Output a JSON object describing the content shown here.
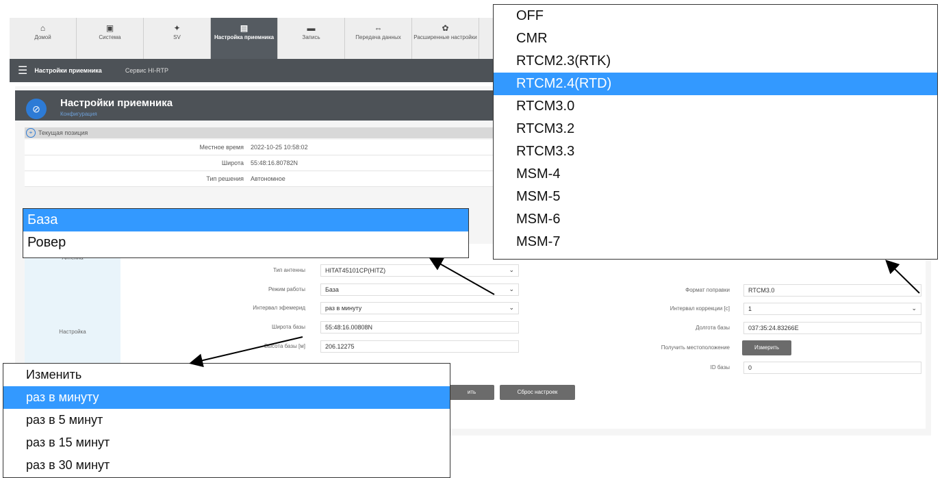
{
  "tabs": [
    {
      "icon": "home-icon",
      "glyph": "⌂",
      "label": "Домой"
    },
    {
      "icon": "system-icon",
      "glyph": "▣",
      "label": "Система"
    },
    {
      "icon": "sv-icon",
      "glyph": "✦",
      "label": "SV"
    },
    {
      "icon": "receiver-icon",
      "glyph": "▤",
      "label": "Настройка приемника"
    },
    {
      "icon": "record-icon",
      "glyph": "▬",
      "label": "Запись"
    },
    {
      "icon": "transfer-icon",
      "glyph": "⇔",
      "label": "Передача данных"
    },
    {
      "icon": "gear-icon",
      "glyph": "✿",
      "label": "Расширенные настройки"
    }
  ],
  "navbar": {
    "crumb": "Настройки приемника",
    "crumb2": "Сервис HI-RTP"
  },
  "page": {
    "title": "Настройки приемника",
    "subtitle": "Конфигурация"
  },
  "position": {
    "section": "Текущая позиция",
    "rows": [
      {
        "label": "Местное время",
        "value": "2022-10-25 10:58:02"
      },
      {
        "label": "Широта",
        "value": "55:48:16.80782N"
      },
      {
        "label": "Тип решения",
        "value": "Автономное"
      }
    ]
  },
  "settings": {
    "antenna_section": "Антенна",
    "setup_section": "Настройка",
    "antenna_type_label": "Тип антенны",
    "antenna_type_value": "HITAT45101CP(HITZ)",
    "mode_label": "Режим работы",
    "mode_value": "База",
    "ephem_label": "Интервал эфемерид",
    "ephem_value": "раз в минуту",
    "lat_label": "Широта базы",
    "lat_value": "55:48:16.00808N",
    "height_label": "Высота базы [м]",
    "height_value": "206.12275",
    "format_label": "Формат поправки",
    "format_value": "RTCM3.0",
    "corr_label": "Интервал коррекции [с]",
    "corr_value": "1",
    "lon_label": "Долгота базы",
    "lon_value": "037:35:24.83266E",
    "getpos_label": "Получить местоположение",
    "measure_btn": "Измерить",
    "id_label": "ID базы",
    "id_value": "0",
    "save_btn": "ить",
    "reset_btn": "Сброс настроек"
  },
  "dropdown_format": {
    "options": [
      "OFF",
      "CMR",
      "RTCM2.3(RTK)",
      "RTCM2.4(RTD)",
      "RTCM3.0",
      "RTCM3.2",
      "RTCM3.3",
      "MSM-4",
      "MSM-5",
      "MSM-6",
      "MSM-7"
    ],
    "selected": "RTCM2.4(RTD)"
  },
  "dropdown_mode": {
    "options": [
      "База",
      "Ровер"
    ],
    "selected": "База"
  },
  "dropdown_interval": {
    "options": [
      "Изменить",
      "раз в минуту",
      "раз в 5 минут",
      "раз в 15 минут",
      "раз в 30 минут"
    ],
    "selected": "раз в минуту"
  },
  "colors": {
    "selection": "#3399ff",
    "header": "#4d5257",
    "accent": "#2d7bd6"
  }
}
